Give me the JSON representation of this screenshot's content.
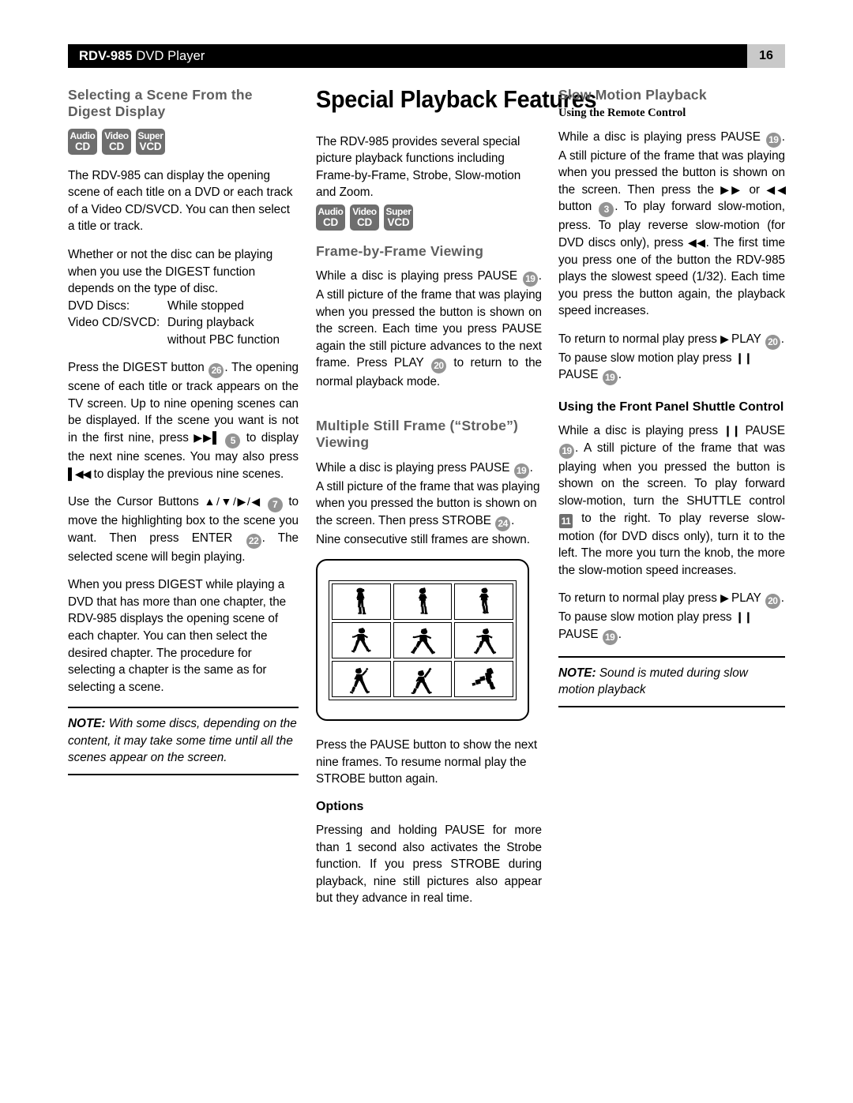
{
  "header": {
    "model": "RDV-985",
    "product": " DVD Player",
    "page_number": "16"
  },
  "disc_badges": [
    {
      "line1": "Audio",
      "line2": "CD"
    },
    {
      "line1": "Video",
      "line2": "CD"
    },
    {
      "line1": "Super",
      "line2": "VCD"
    }
  ],
  "colors": {
    "heading_gray": "#5e5e5e",
    "badge_gray": "#6e6e6e",
    "number_badge_gray": "#949494",
    "page_number_bg": "#c9c9c9",
    "header_bar": "#000000"
  },
  "left_column": {
    "heading": "Selecting a Scene From the Digest Display",
    "para1": "The RDV-985 can display the opening scene of each title on a DVD or each track of a Video CD/SVCD. You can then select a title or track.",
    "para2": "Whether or not the disc can be playing when you use the DIGEST function depends on the type of disc.",
    "deflist": [
      {
        "term": "DVD Discs:",
        "value": "While stopped"
      },
      {
        "term": "Video CD/SVCD:",
        "value": "During playback"
      },
      {
        "term": "",
        "value": "without PBC function"
      }
    ],
    "para3_pre": "Press the DIGEST button ",
    "para3_badge1": "26",
    "para3_mid1": ". The opening scene of each title or track appears on the TV screen. Up to nine opening scenes can be displayed. If the scene you want is not in the first nine, press ",
    "para3_icon1": "▶▶▌",
    "para3_badge2": "5",
    "para3_mid2": " to display the next nine scenes. You may also press ",
    "para3_icon2": "▌◀◀",
    "para3_end": " to display the previous nine scenes.",
    "para4_pre": "Use the Cursor Buttons ",
    "para4_icons": "▲/▼/▶/◀",
    "para4_badge1": "7",
    "para4_mid": " to move the highlighting box to the scene you want. Then press ENTER ",
    "para4_badge2": "22",
    "para4_end": ". The selected scene will begin playing.",
    "para5": "When you press DIGEST while playing a DVD that has more than one chapter, the RDV-985 displays the opening scene of each chapter. You can then select the desired chapter. The procedure for selecting a chapter is the same as for selecting a scene.",
    "note_label": "NOTE:",
    "note_text": " With some discs, depending on the content, it may take some time until all the scenes appear on the screen."
  },
  "middle_column": {
    "title": "Special Playback Features",
    "intro": "The RDV-985 provides several special picture playback functions including Frame-by-Frame, Strobe, Slow-motion and Zoom.",
    "frame_heading": "Frame-by-Frame Viewing",
    "frame_para_pre": "While a disc is playing press PAUSE ",
    "frame_badge1": "19",
    "frame_para_mid": ". A still picture of the frame that was playing when you pressed the button is shown on the screen. Each time you press PAUSE again the still picture advances to the next frame. Press PLAY ",
    "frame_badge2": "20",
    "frame_para_end": " to return to the normal playback mode.",
    "strobe_heading": "Multiple Still Frame (“Strobe”) Viewing",
    "strobe_para_pre": "While a disc is playing press PAUSE ",
    "strobe_badge1": "19",
    "strobe_para_mid": ". A still picture of the frame that was playing when you pressed the button is shown on the screen. Then press STROBE ",
    "strobe_badge2": "24",
    "strobe_para_end": ". Nine consecutive still frames are shown.",
    "figure_alt": "tv-screen-nine-frames-baseball-pitcher",
    "after_figure": "Press the PAUSE button to show the next nine frames. To resume normal play the STROBE button again.",
    "options_heading": "Options",
    "options_para": "Pressing and holding PAUSE for more than 1 second also activates the Strobe function. If you press STROBE during playback, nine still pictures also appear but they advance in real time."
  },
  "right_column": {
    "heading": "Slow Motion Playback",
    "subhead1": "Using the Remote Control",
    "para1_pre": "While a disc is playing press PAUSE ",
    "para1_badge1": "19",
    "para1_mid1": ". A still picture of the frame that was playing when you pressed the button is shown on the screen. Then press the ",
    "para1_icon1": "▶▶",
    "para1_or": " or ",
    "para1_icon2": "◀◀",
    "para1_mid2": " button ",
    "para1_badge2": "3",
    "para1_mid3": ". To play forward slow-motion, press. To play reverse slow-motion (for DVD discs only), press ",
    "para1_icon3": "◀◀",
    "para1_end": ". The first time you press one of the button the RDV-985 plays the slowest speed (1/32). Each time you press the button again, the playback speed increases.",
    "para2_pre": "To return to normal play press ",
    "para2_icon1": "▶",
    "para2_mid1": " PLAY ",
    "para2_badge1": "20",
    "para2_mid2": ". To pause slow motion play press ",
    "para2_icon2": "❙❙",
    "para2_mid3": " PAUSE ",
    "para2_badge2": "19",
    "para2_end": ".",
    "subhead2": "Using the Front Panel Shuttle Control",
    "para3_pre": "While a disc is playing press ",
    "para3_icon1": "❙❙",
    "para3_mid1": " PAUSE ",
    "para3_badge1": "19",
    "para3_mid2": ". A still picture of the frame that was playing when you pressed the button is shown on the screen. To play forward slow-motion, turn the SHUTTLE control ",
    "para3_badge2": "11",
    "para3_end": " to the right. To play reverse slow-motion (for DVD discs only), turn it to the left. The more you turn the knob, the more the slow-motion speed increases.",
    "para4_pre": "To return to normal play press ",
    "para4_icon1": "▶",
    "para4_mid1": " PLAY ",
    "para4_badge1": "20",
    "para4_mid2": ". To pause slow motion play press ",
    "para4_icon2": "❙❙",
    "para4_mid3": " PAUSE ",
    "para4_badge2": "19",
    "para4_end": ".",
    "note_label": "NOTE:",
    "note_text": " Sound is muted during slow motion playback"
  }
}
